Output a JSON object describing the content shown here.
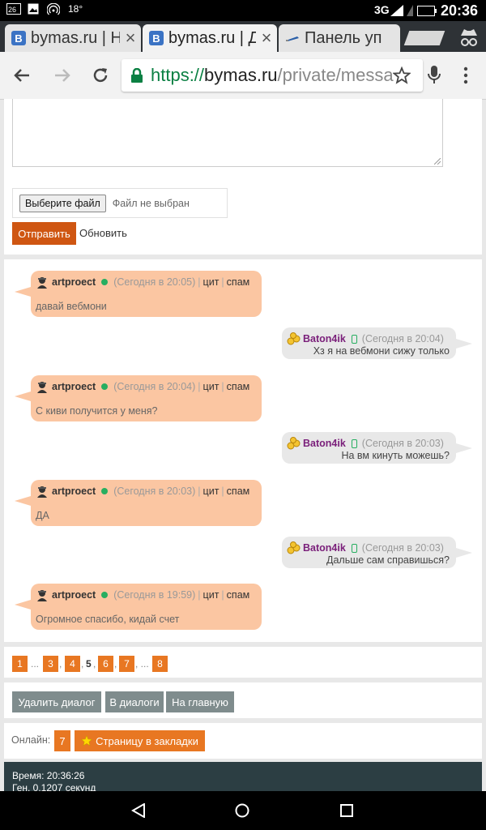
{
  "status_bar": {
    "left_icons": [
      "gallery-icon",
      "image-icon",
      "hotspot-icon"
    ],
    "temperature": "18°",
    "network": "3G",
    "time": "20:36"
  },
  "tabs": [
    {
      "title": "bymas.ru | Н",
      "favicon": "B",
      "close": "×"
    },
    {
      "title": "bymas.ru | Д",
      "favicon": "B",
      "close": "×"
    },
    {
      "title": "Панель уп",
      "favicon": "pen-icon",
      "close": ""
    }
  ],
  "address_bar": {
    "scheme": "https://",
    "host": "bymas.ru",
    "path": "/private/messa"
  },
  "form": {
    "file_button": "Выберите файл",
    "file_placeholder": "Файл не выбран",
    "send_label": "Отправить",
    "refresh_label": "Обновить"
  },
  "messages": [
    {
      "side": "left",
      "user": "artproect",
      "time": "(Сегодня в 20:05)",
      "cite": "цит",
      "spam": "спам",
      "text": "давай вебмони"
    },
    {
      "side": "right",
      "user": "Baton4ik",
      "time": "(Сегодня в 20:04)",
      "text": "Хз я на вебмони сижу только"
    },
    {
      "side": "left",
      "user": "artproect",
      "time": "(Сегодня в 20:04)",
      "cite": "цит",
      "spam": "спам",
      "text": "С киви получится у меня?"
    },
    {
      "side": "right",
      "user": "Baton4ik",
      "time": "(Сегодня в 20:03)",
      "text": "На вм кинуть можешь?"
    },
    {
      "side": "left",
      "user": "artproect",
      "time": "(Сегодня в 20:03)",
      "cite": "цит",
      "spam": "спам",
      "text": "ДА"
    },
    {
      "side": "right",
      "user": "Baton4ik",
      "time": "(Сегодня в 20:03)",
      "text": "Дальше сам справишься?"
    },
    {
      "side": "left",
      "user": "artproect",
      "time": "(Сегодня в 19:59)",
      "cite": "цит",
      "spam": "спам",
      "text": "Огромное спасибо, кидай счет"
    }
  ],
  "pagination": {
    "items": [
      "1",
      "...",
      "3",
      ",",
      "4",
      ",",
      "5",
      ",",
      "6",
      ",",
      "7",
      ", ...",
      "8"
    ],
    "current": "5"
  },
  "actions": {
    "delete_dialog": "Удалить диалог",
    "to_dialogs": "В диалоги",
    "to_home": "На главную"
  },
  "online": {
    "label": "Онлайн:",
    "count": "7",
    "bookmark": "Страницу в закладки"
  },
  "footer": {
    "time": "Время: 20:36:26",
    "gen": "Ген. 0.1207 секунд"
  },
  "colors": {
    "accent_orange": "#e87722",
    "send_button": "#cf5612",
    "left_bubble": "#fbc6a2",
    "right_bubble": "#e8e8e8",
    "gray_button": "#7f8c8d",
    "footer_bg": "#2c3e43"
  }
}
